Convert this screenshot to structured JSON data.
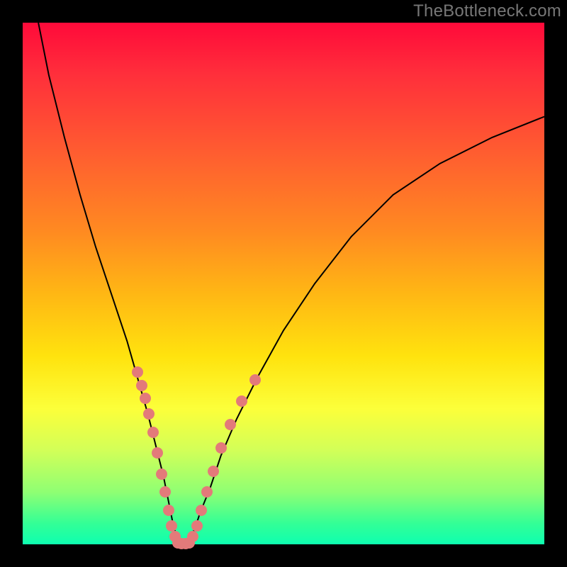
{
  "watermark": "TheBottleneck.com",
  "chart_data": {
    "type": "line",
    "title": "",
    "xlabel": "",
    "ylabel": "",
    "xlim": [
      0,
      100
    ],
    "ylim": [
      0,
      100
    ],
    "background_gradient": {
      "top": "#ff0a3a",
      "mid": "#ffe30e",
      "bottom": "#0effb0"
    },
    "series": [
      {
        "name": "curve",
        "stroke": "#000000",
        "x": [
          3,
          5,
          8,
          11,
          14,
          17,
          20,
          22,
          24,
          25.5,
          27,
          28,
          28.8,
          29.5,
          30,
          31,
          32,
          33,
          34,
          36,
          38,
          41,
          45,
          50,
          56,
          63,
          71,
          80,
          90,
          100
        ],
        "y": [
          100,
          90,
          78,
          67,
          57,
          48,
          39,
          32,
          25,
          19,
          13,
          8,
          4,
          1.5,
          0,
          0,
          1,
          3,
          6,
          11,
          17,
          24,
          32,
          41,
          50,
          59,
          67,
          73,
          78,
          82
        ]
      }
    ],
    "scatter": [
      {
        "name": "dots-left",
        "color": "#e37a7a",
        "points": [
          {
            "x": 22.0,
            "y": 33.0
          },
          {
            "x": 22.8,
            "y": 30.5
          },
          {
            "x": 23.5,
            "y": 28.0
          },
          {
            "x": 24.2,
            "y": 25.0
          },
          {
            "x": 25.0,
            "y": 21.5
          },
          {
            "x": 25.8,
            "y": 17.5
          },
          {
            "x": 26.6,
            "y": 13.5
          },
          {
            "x": 27.3,
            "y": 10.0
          },
          {
            "x": 28.0,
            "y": 6.5
          },
          {
            "x": 28.6,
            "y": 3.5
          },
          {
            "x": 29.2,
            "y": 1.5
          }
        ]
      },
      {
        "name": "dots-bottom",
        "color": "#e37a7a",
        "points": [
          {
            "x": 29.8,
            "y": 0.3
          },
          {
            "x": 30.5,
            "y": 0.1
          },
          {
            "x": 31.2,
            "y": 0.1
          },
          {
            "x": 31.9,
            "y": 0.3
          }
        ]
      },
      {
        "name": "dots-right",
        "color": "#e37a7a",
        "points": [
          {
            "x": 32.6,
            "y": 1.5
          },
          {
            "x": 33.4,
            "y": 3.5
          },
          {
            "x": 34.3,
            "y": 6.5
          },
          {
            "x": 35.3,
            "y": 10.0
          },
          {
            "x": 36.5,
            "y": 14.0
          },
          {
            "x": 38.0,
            "y": 18.5
          },
          {
            "x": 39.8,
            "y": 23.0
          },
          {
            "x": 42.0,
            "y": 27.5
          },
          {
            "x": 44.5,
            "y": 31.5
          }
        ]
      }
    ]
  }
}
